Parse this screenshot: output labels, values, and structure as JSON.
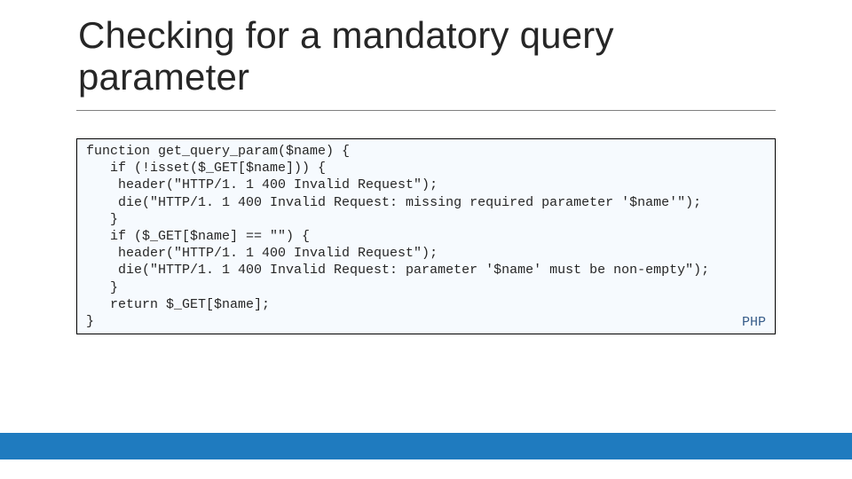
{
  "title": "Checking for a mandatory query parameter",
  "code": {
    "language_label": "PHP",
    "lines": [
      "function get_query_param($name) {",
      "   if (!isset($_GET[$name])) {",
      "    header(\"HTTP/1. 1 400 Invalid Request\");",
      "    die(\"HTTP/1. 1 400 Invalid Request: missing required parameter '$name'\");",
      "   }",
      "   if ($_GET[$name] == \"\") {",
      "    header(\"HTTP/1. 1 400 Invalid Request\");",
      "    die(\"HTTP/1. 1 400 Invalid Request: parameter '$name' must be non-empty\");",
      "   }",
      "   return $_GET[$name];",
      "}"
    ]
  }
}
